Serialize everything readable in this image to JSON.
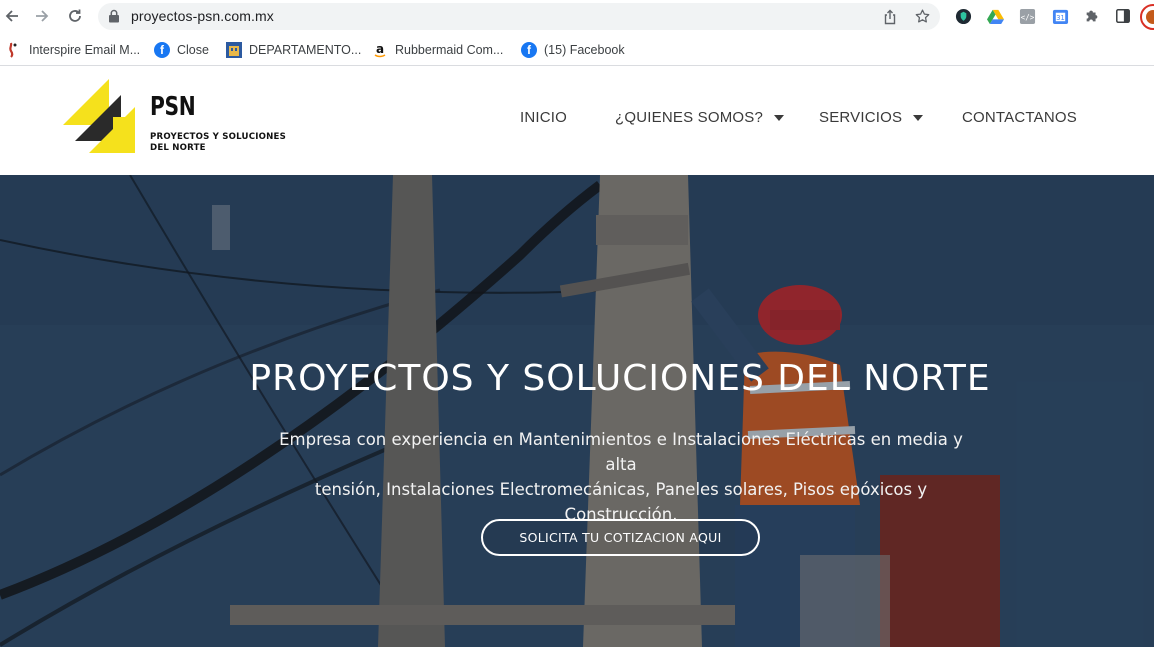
{
  "browser": {
    "url": "proyectos-psn.com.mx",
    "bookmarks": [
      {
        "label": "Interspire Email M...",
        "icon": "interspire-icon"
      },
      {
        "label": "Close",
        "icon": "facebook-icon"
      },
      {
        "label": "DEPARTAMENTO...",
        "icon": "building-icon"
      },
      {
        "label": "Rubbermaid Com...",
        "icon": "amazon-icon"
      },
      {
        "label": "(15) Facebook",
        "icon": "facebook-icon"
      }
    ]
  },
  "site": {
    "logo": {
      "name": "PSN",
      "sub_line1": "PROYECTOS Y SOLUCIONES",
      "sub_line2": "DEL NORTE"
    },
    "nav": [
      {
        "label": "INICIO",
        "dropdown": false
      },
      {
        "label": "¿QUIENES SOMOS?",
        "dropdown": true
      },
      {
        "label": "SERVICIOS",
        "dropdown": true
      },
      {
        "label": "CONTACTANOS",
        "dropdown": false
      }
    ]
  },
  "hero": {
    "title": "PROYECTOS Y SOLUCIONES DEL NORTE",
    "text_line1": "Empresa con experiencia en Mantenimientos e Instalaciones Eléctricas en media y alta",
    "text_line2": "tensión, Instalaciones Electromecánicas, Paneles solares, Pisos epóxicos y Construcción.",
    "cta": "SOLICITA TU COTIZACION AQUI"
  },
  "colors": {
    "brand_yellow": "#f5e11c",
    "brand_dark": "#222222",
    "hero_overlay": "#2d4763"
  }
}
